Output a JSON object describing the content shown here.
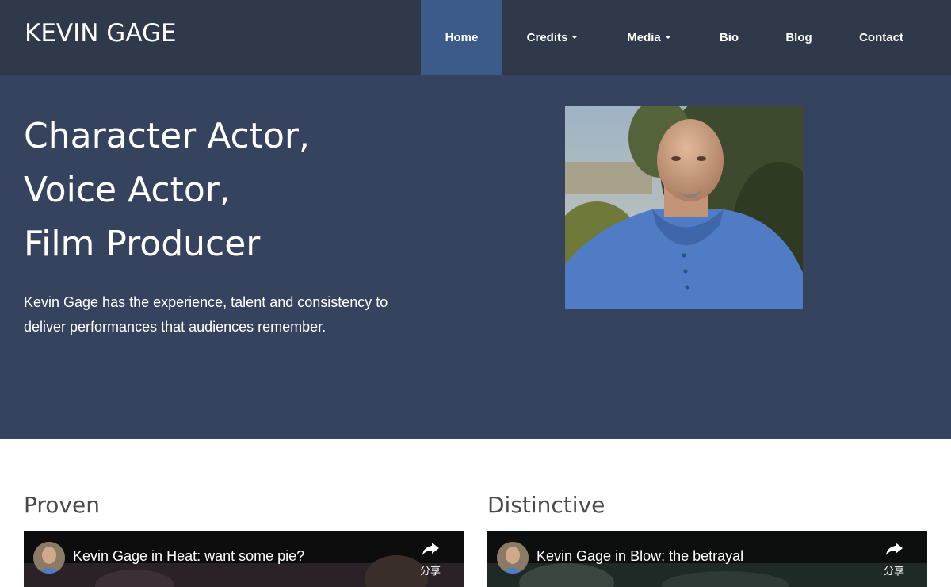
{
  "site": {
    "brand": "KEVIN GAGE"
  },
  "nav": {
    "items": [
      {
        "label": "Home",
        "active": true,
        "has_dropdown": false
      },
      {
        "label": "Credits",
        "active": false,
        "has_dropdown": true
      },
      {
        "label": "Media",
        "active": false,
        "has_dropdown": true
      },
      {
        "label": "Bio",
        "active": false,
        "has_dropdown": false
      },
      {
        "label": "Blog",
        "active": false,
        "has_dropdown": false
      },
      {
        "label": "Contact",
        "active": false,
        "has_dropdown": false
      }
    ]
  },
  "hero": {
    "headline": [
      "Character Actor,",
      "Voice Actor,",
      "Film Producer"
    ],
    "tagline": "Kevin Gage has the experience, talent and consistency to deliver performances that audiences remember."
  },
  "sections": [
    {
      "title": "Proven",
      "video": {
        "title": "Kevin Gage in Heat: want some pie?",
        "share_label": "分享"
      }
    },
    {
      "title": "Distinctive",
      "video": {
        "title": "Kevin Gage in Blow: the betrayal",
        "share_label": "分享"
      }
    }
  ],
  "colors": {
    "navbar": "#30394a",
    "nav_active": "#3c5a8a",
    "hero": "#35435e"
  }
}
